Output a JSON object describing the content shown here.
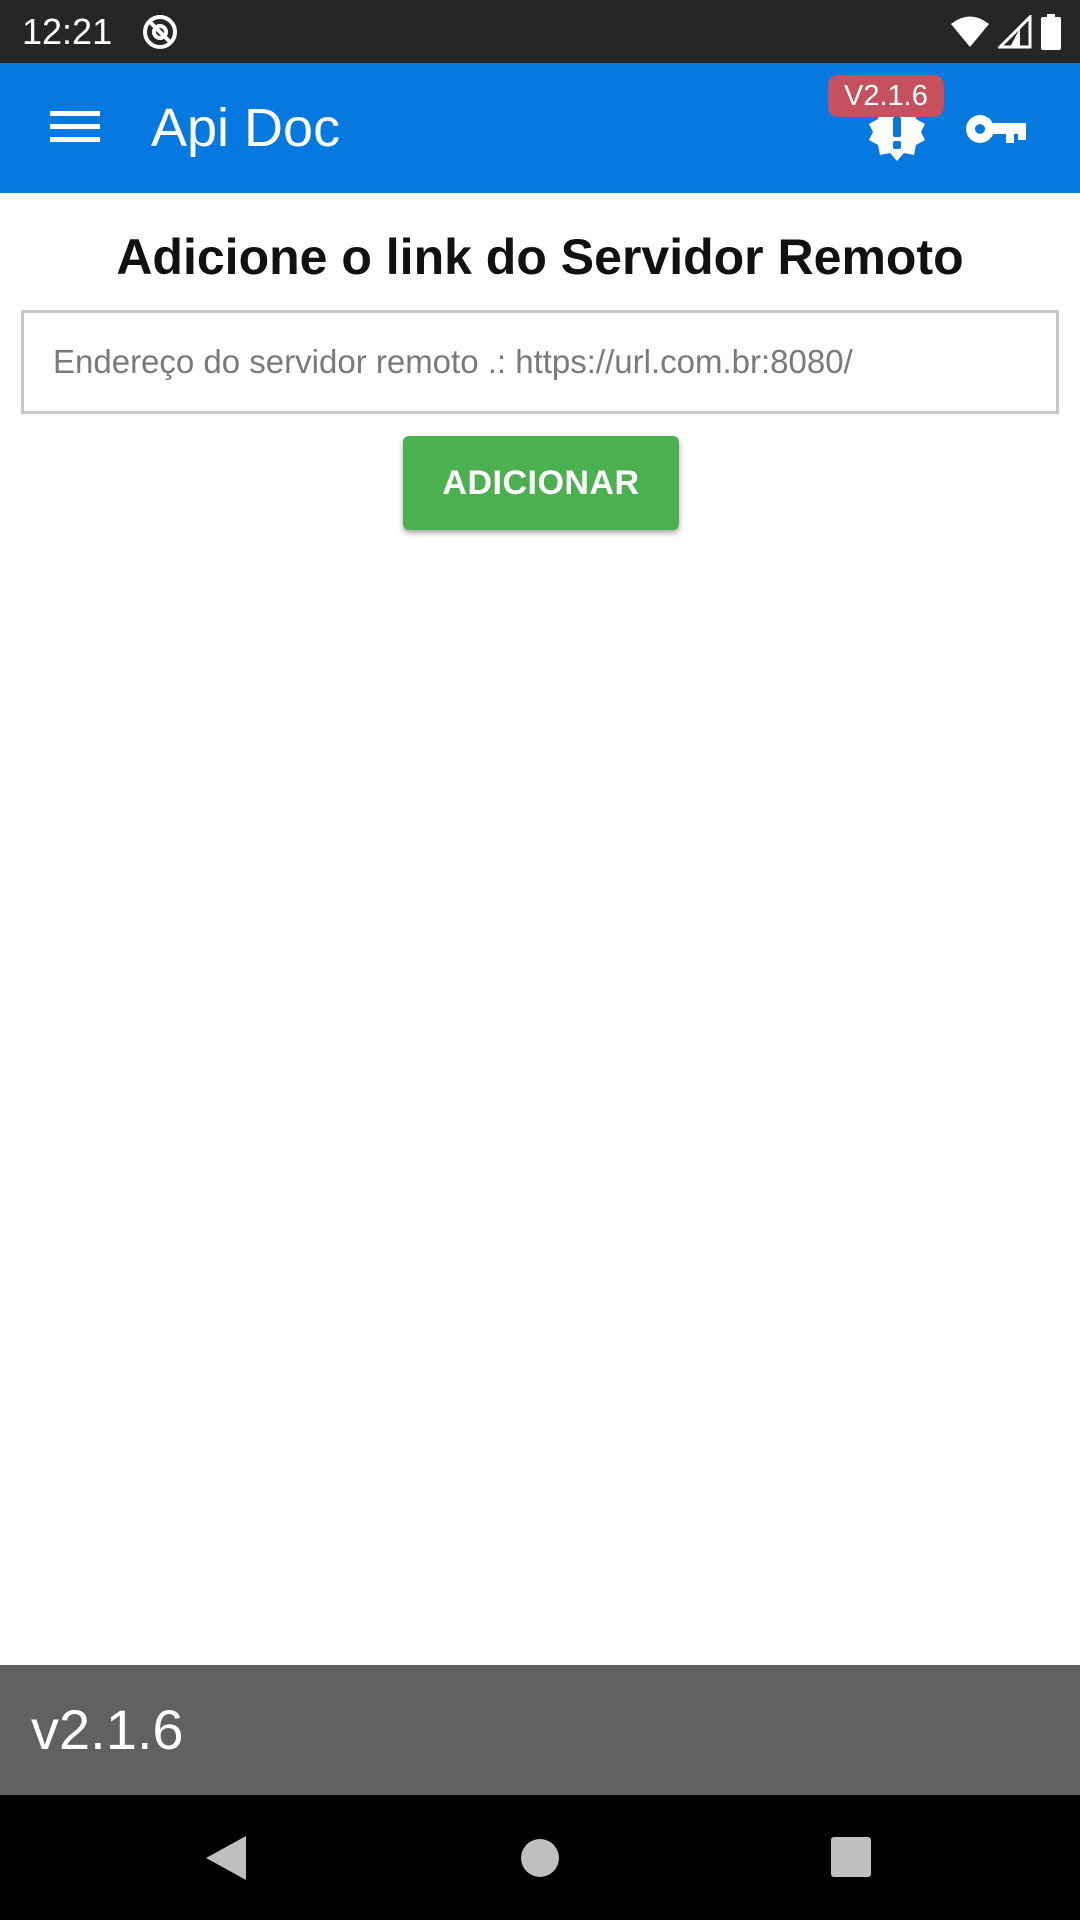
{
  "status_bar": {
    "time": "12:21",
    "icons": [
      "at-sign-icon",
      "wifi-icon",
      "signal-icon",
      "battery-icon"
    ]
  },
  "app_bar": {
    "title": "Api Doc",
    "version_badge": "V2.1.6",
    "background_color": "#0679e0",
    "badge_color": "#c5515f",
    "icons": [
      "menu-icon",
      "alert-badge-icon",
      "key-icon"
    ]
  },
  "main": {
    "heading": "Adicione o link do Servidor Remoto",
    "server_input": {
      "placeholder": "Endereço do servidor remoto .: https://url.com.br:8080/",
      "value": ""
    },
    "add_button_label": "ADICIONAR",
    "add_button_color": "#4caf50"
  },
  "footer": {
    "version": "v2.1.6",
    "background_color": "#616161"
  },
  "nav_bar": {
    "icons": [
      "back-icon",
      "home-icon",
      "recents-icon"
    ]
  }
}
